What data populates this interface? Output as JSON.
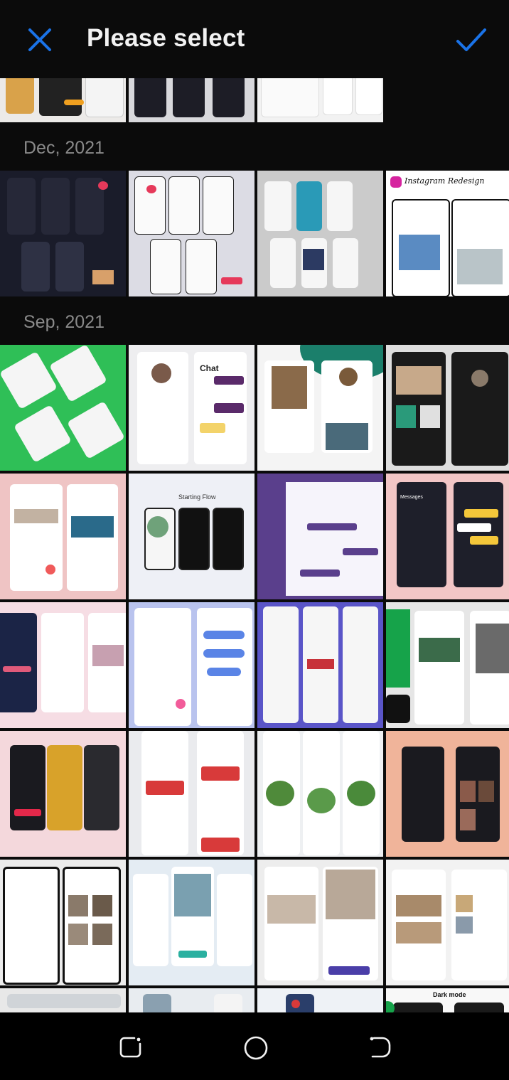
{
  "header": {
    "title": "Please select",
    "close_icon": "close-icon",
    "confirm_icon": "check-icon",
    "accent_color": "#1a73e8"
  },
  "sections": [
    {
      "label": "Dec, 2021"
    },
    {
      "label": "Sep, 2021"
    }
  ],
  "thumb_texts": {
    "instagram": "Instagram Redesign",
    "chat": "Chat",
    "messages": "Messages",
    "starting_flow": "Starting Flow",
    "dark_mode": "Dark mode"
  },
  "navbar": {
    "recent_icon": "recent-apps-icon",
    "home_icon": "home-icon",
    "back_icon": "back-icon"
  }
}
